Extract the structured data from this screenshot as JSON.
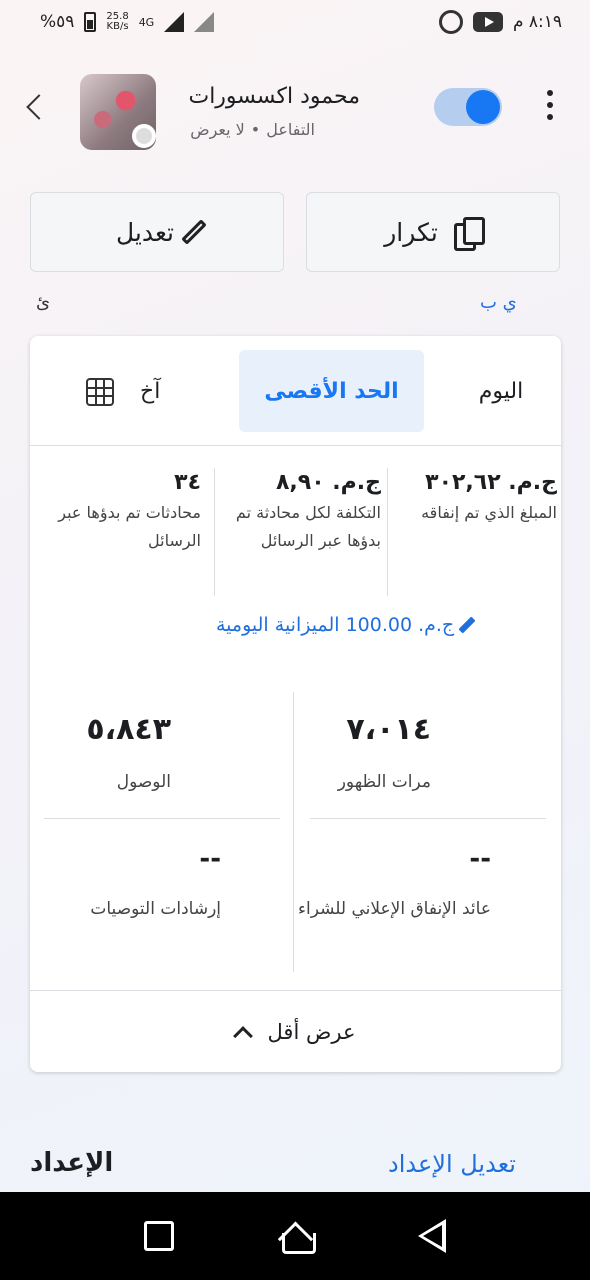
{
  "status_bar": {
    "battery": "%٥٩",
    "net_speed_value": "25.8",
    "net_speed_unit": "KB/s",
    "network_type": "4G",
    "time": "٨:١٩ م"
  },
  "header": {
    "page_name": "محمود اكسسورات",
    "subtitle_status": "التفاعل",
    "subtitle_separator": "•",
    "subtitle_delivery": "لا يعرض",
    "toggle_on": true
  },
  "actions": {
    "edit_label": "تعديل",
    "duplicate_label": "تكرار"
  },
  "peek": {
    "right_text": "ي ب",
    "left_text": "ئ"
  },
  "tabs": [
    {
      "label": "اليوم",
      "selected": false
    },
    {
      "label": "الحد الأقصى",
      "selected": true
    },
    {
      "label": "آخ",
      "selected": false
    }
  ],
  "summary": [
    {
      "value": "ج.م. ٣٠٢,٦٢",
      "label": "المبلغ الذي تم إنفاقه"
    },
    {
      "value": "ج.م. ٨,٩٠",
      "label": "التكلفة لكل محادثة تم بدؤها عبر الرسائل"
    },
    {
      "value": "٣٤",
      "label": "محادثات تم بدؤها عبر الرسائل"
    }
  ],
  "budget": {
    "text": "ج.م. 100.00 الميزانية اليومية"
  },
  "metrics": [
    {
      "value": "٧،٠١٤",
      "label": "مرات الظهور"
    },
    {
      "value": "٥،٨٤٣",
      "label": "الوصول"
    },
    {
      "value": "--",
      "label": "عائد الإنفاق الإعلاني للشراء"
    },
    {
      "value": "--",
      "label": "إرشادات التوصيات"
    }
  ],
  "show_less_label": "عرض أقل",
  "setup": {
    "title": "الإعداد",
    "edit_link": "تعديل الإعداد"
  },
  "colors": {
    "accent": "#1877f2",
    "link": "#216fdb",
    "tab_selected_bg": "#e7f0fb"
  }
}
